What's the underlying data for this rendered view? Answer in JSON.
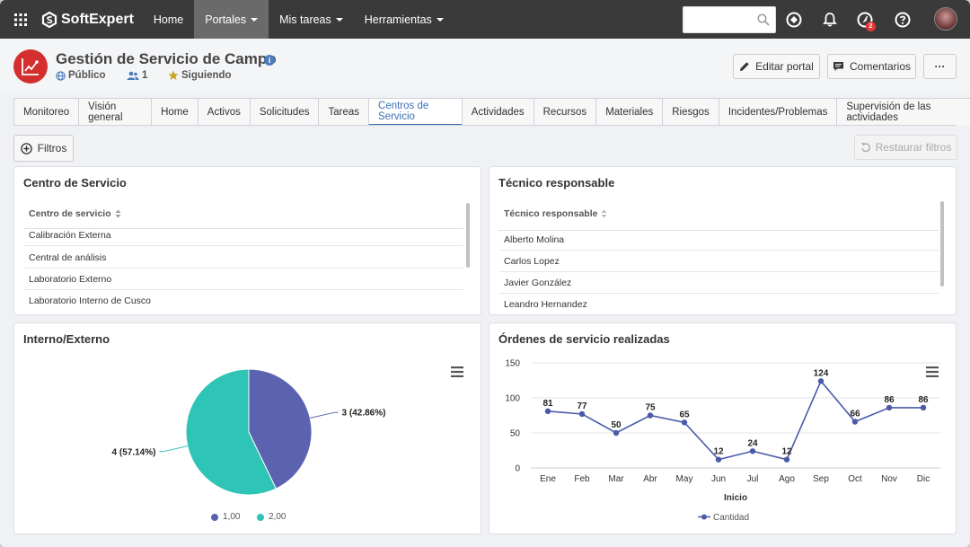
{
  "topbar": {
    "brand": "SoftExpert",
    "nav": [
      {
        "label": "Home",
        "dropdown": false,
        "active": false
      },
      {
        "label": "Portales",
        "dropdown": true,
        "active": true
      },
      {
        "label": "Mis tareas",
        "dropdown": true,
        "active": false
      },
      {
        "label": "Herramientas",
        "dropdown": true,
        "active": false
      }
    ],
    "search_placeholder": "",
    "notification_badge": "2"
  },
  "header": {
    "title": "Gestión de Servicio de Campo",
    "visibility": "Público",
    "members": "1",
    "following": "Siguiendo",
    "edit_label": "Editar portal",
    "comments_label": "Comentarios",
    "more_label": "···"
  },
  "tabs": [
    "Monitoreo",
    "Visión general",
    "Home",
    "Activos",
    "Solicitudes",
    "Tareas",
    "Centros de Servicio",
    "Actividades",
    "Recursos",
    "Materiales",
    "Riesgos",
    "Incidentes/Problemas",
    "Supervisión de las actividades"
  ],
  "active_tab": "Centros de Servicio",
  "filters_label": "Filtros",
  "restore_label": "Restaurar filtros",
  "panels": {
    "service_center": {
      "title": "Centro de Servicio",
      "column": "Centro de servicio",
      "rows": [
        "Calibración Externa",
        "Central de análisis",
        "Laboratorio Externo",
        "Laboratorio Interno de Cusco"
      ]
    },
    "technician": {
      "title": "Técnico responsable",
      "column": "Técnico responsable",
      "rows": [
        "Alberto Molina",
        "Carlos Lopez",
        "Javier González",
        "Leandro Hernandez"
      ]
    },
    "internal_external": {
      "title": "Interno/Externo"
    },
    "orders": {
      "title": "Órdenes de servicio realizadas"
    }
  },
  "chart_data": [
    {
      "type": "pie",
      "title": "Interno/Externo",
      "slices": [
        {
          "name": "1,00",
          "value": 4,
          "label": "4 (57.14%)",
          "color": "#2ec4b6"
        },
        {
          "name": "2,00",
          "value": 3,
          "label": "3 (42.86%)",
          "color": "#5b63b0"
        }
      ],
      "legend": [
        {
          "name": "1,00",
          "color": "#5b63b0"
        },
        {
          "name": "2,00",
          "color": "#2ec4b6"
        }
      ],
      "legend_position": "bottom"
    },
    {
      "type": "line",
      "title": "Órdenes de servicio realizadas",
      "xlabel": "Inicio",
      "ylabel": "",
      "categories": [
        "Ene",
        "Feb",
        "Mar",
        "Abr",
        "May",
        "Jun",
        "Jul",
        "Ago",
        "Sep",
        "Oct",
        "Nov",
        "Dic"
      ],
      "series": [
        {
          "name": "Cantidad",
          "values": [
            81,
            77,
            50,
            75,
            65,
            12,
            24,
            12,
            124,
            66,
            86,
            86
          ],
          "color": "#4a5aa8"
        }
      ],
      "ylim": [
        0,
        150
      ],
      "yticks": [
        0,
        50,
        100,
        150
      ],
      "grid": true,
      "legend_position": "bottom"
    }
  ]
}
